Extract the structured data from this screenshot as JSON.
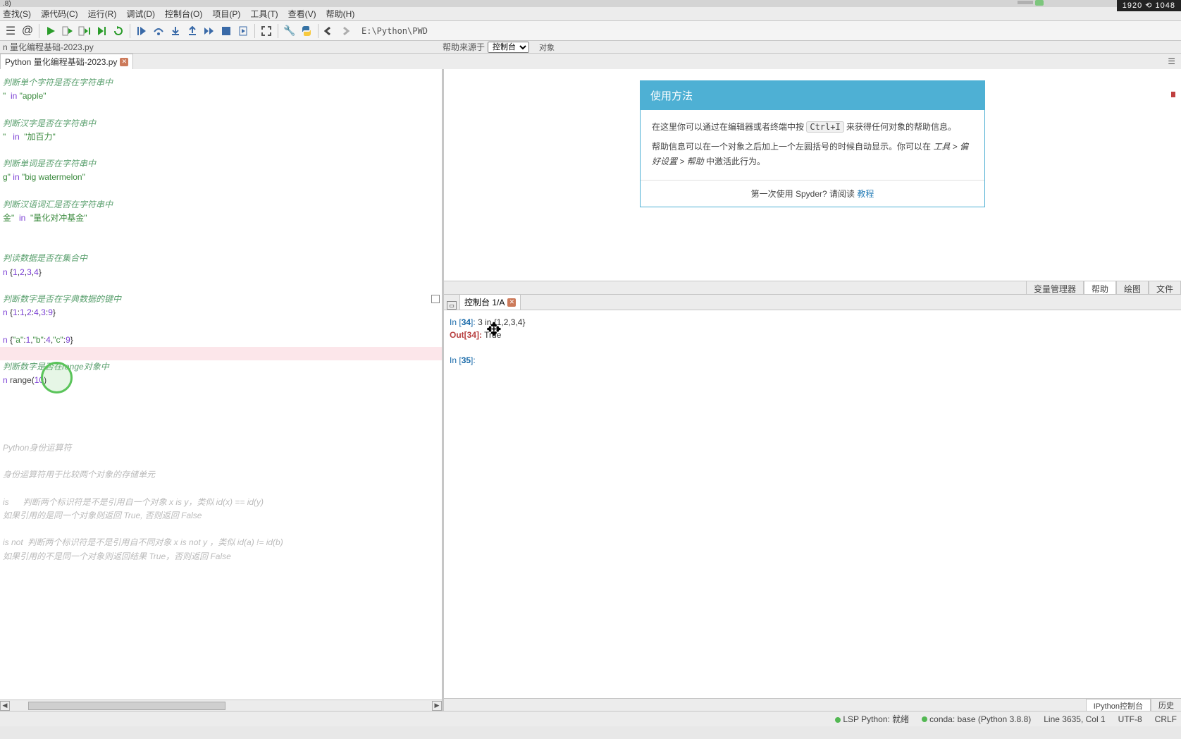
{
  "window": {
    "title_fragment": ".8)",
    "dimensions": "1920 ⟲ 1048"
  },
  "menu": [
    "查找(S)",
    "源代码(C)",
    "运行(R)",
    "调试(D)",
    "控制台(O)",
    "项目(P)",
    "工具(T)",
    "查看(V)",
    "帮助(H)"
  ],
  "toolbar_path": "E:\\Python\\PWD",
  "breadcrumb": "n 量化编程基础-2023.py",
  "file_tab": "Python 量化编程基础-2023.py",
  "help_source": {
    "label": "帮助来源于",
    "selected": "控制台",
    "object": "对象"
  },
  "editor": {
    "lines": [
      {
        "cls": "cm-comment",
        "t": "判断单个字符是否在字符串中"
      },
      {
        "raw": "<span class='cm-string'>\"</span>  <span class='cm-keyword'>in</span> <span class='cm-string'>\"apple\"</span>"
      },
      {
        "t": ""
      },
      {
        "cls": "cm-comment",
        "t": "判断汉字是否在字符串中"
      },
      {
        "raw": "<span class='cm-string'>\"</span>   <span class='cm-keyword'>in</span>  <span class='cm-string'>\"加百力\"</span>"
      },
      {
        "t": ""
      },
      {
        "cls": "cm-comment",
        "t": "判断单词是否在字符串中"
      },
      {
        "raw": "<span class='cm-string'>g\"</span> <span class='cm-keyword'>in</span> <span class='cm-string'>\"big watermelon\"</span>"
      },
      {
        "t": ""
      },
      {
        "cls": "cm-comment",
        "t": "判断汉语词汇是否在字符串中"
      },
      {
        "raw": "<span class='cm-string'>金\"</span>  <span class='cm-keyword'>in</span>  <span class='cm-string'>\"量化对冲基金\"</span>"
      },
      {
        "t": ""
      },
      {
        "t": ""
      },
      {
        "cls": "cm-comment",
        "t": "判读数据是否在集合中"
      },
      {
        "raw": "<span class='cm-keyword'>n</span> {<span class='cm-num'>1</span>,<span class='cm-num'>2</span>,<span class='cm-num'>3</span>,<span class='cm-num'>4</span>}"
      },
      {
        "t": ""
      },
      {
        "cls": "cm-comment",
        "t": "判断数字是否在字典数据的键中"
      },
      {
        "raw": "<span class='cm-keyword'>n</span> {<span class='cm-num'>1</span>:<span class='cm-num'>1</span>,<span class='cm-num'>2</span>:<span class='cm-num'>4</span>,<span class='cm-num'>3</span>:<span class='cm-num'>9</span>}"
      },
      {
        "t": ""
      },
      {
        "raw": "<span class='cm-keyword'>n</span> {<span class='cm-string'>\"a\"</span>:<span class='cm-num'>1</span>,<span class='cm-string'>\"b\"</span>:<span class='cm-num'>4</span>,<span class='cm-string'>\"c\"</span>:<span class='cm-num'>9</span>}"
      },
      {
        "t": "",
        "hl": true
      },
      {
        "cls": "cm-comment",
        "t": "判断数字是否在range对象中"
      },
      {
        "raw": "<span class='cm-keyword'>n</span> <span class='cm-builtin'>range</span>(<span class='cm-num'>10</span>)"
      },
      {
        "t": ""
      },
      {
        "t": ""
      },
      {
        "t": ""
      },
      {
        "t": ""
      },
      {
        "cls": "cm-light",
        "t": "Python身份运算符"
      },
      {
        "t": ""
      },
      {
        "cls": "cm-light",
        "t": "身份运算符用于比较两个对象的存储单元"
      },
      {
        "t": ""
      },
      {
        "cls": "cm-light",
        "t": "is      判断两个标识符是不是引用自一个对象 x is y，类似 id(x) == id(y)"
      },
      {
        "cls": "cm-light",
        "t": "如果引用的是同一个对象则返回 True, 否则返回 False"
      },
      {
        "t": ""
      },
      {
        "cls": "cm-light",
        "t": "is not  判断两个标识符是不是引用自不同对象 x is not y ，类似 id(a) != id(b)"
      },
      {
        "cls": "cm-light",
        "t": "如果引用的不是同一个对象则返回结果 True，否则返回 False"
      }
    ]
  },
  "help_panel": {
    "title": "使用方法",
    "body1_a": "在这里你可以通过在编辑器或者终端中按 ",
    "body1_kbd": "Ctrl+I",
    "body1_b": " 来获得任何对象的帮助信息。",
    "body2_a": "帮助信息可以在一个对象之后加上一个左圆括号的时候自动显示。你可以在 ",
    "body2_i1": "工具 > 偏好设置 > 帮助",
    "body2_b": " 中激活此行为。",
    "footer_a": "第一次使用 Spyder? 请阅读 ",
    "footer_link": "教程"
  },
  "mid_tabs": [
    "变量管理器",
    "帮助",
    "绘图",
    "文件"
  ],
  "mid_active": 1,
  "console_tab": "控制台 1/A",
  "console": {
    "in34_no": "34",
    "in34_code": "3 in {1,2,3,4}",
    "out34_no": "34",
    "out34_val": "True",
    "in35_no": "35"
  },
  "bottom_tabs": [
    "IPython控制台",
    "历史"
  ],
  "status": {
    "lsp": "LSP Python: 就绪",
    "conda": "conda: base (Python 3.8.8)",
    "line": "Line 3635, Col 1",
    "enc": "UTF-8",
    "eol": "CRLF"
  }
}
